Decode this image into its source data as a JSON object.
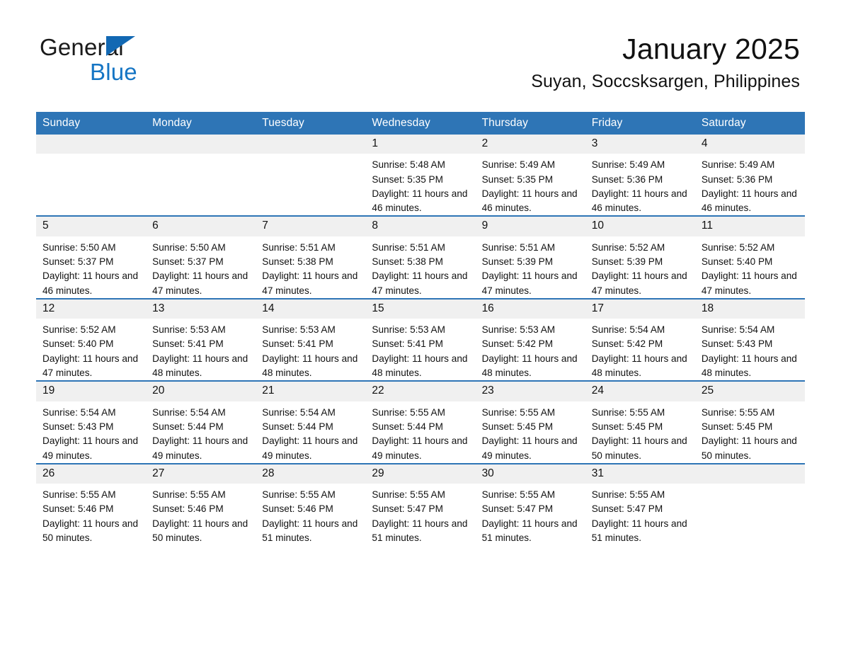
{
  "brand": {
    "name_part1": "General",
    "name_part2": "Blue",
    "triangle_icon": "blue-triangle-icon",
    "accent_color": "#1575c4"
  },
  "header": {
    "title": "January 2025",
    "subtitle": "Suyan, Soccsksargen, Philippines"
  },
  "theme": {
    "header_blue": "#2e75b6",
    "daynum_gray": "#f0f0f0",
    "text": "#111111"
  },
  "weekday_headers": [
    "Sunday",
    "Monday",
    "Tuesday",
    "Wednesday",
    "Thursday",
    "Friday",
    "Saturday"
  ],
  "labels": {
    "sunrise_prefix": "Sunrise:",
    "sunset_prefix": "Sunset:",
    "daylight_prefix": "Daylight:"
  },
  "weeks": [
    [
      {
        "day": "",
        "empty": true
      },
      {
        "day": "",
        "empty": true
      },
      {
        "day": "",
        "empty": true
      },
      {
        "day": "1",
        "sunrise": "Sunrise: 5:48 AM",
        "sunset": "Sunset: 5:35 PM",
        "daylight": "Daylight: 11 hours and 46 minutes."
      },
      {
        "day": "2",
        "sunrise": "Sunrise: 5:49 AM",
        "sunset": "Sunset: 5:35 PM",
        "daylight": "Daylight: 11 hours and 46 minutes."
      },
      {
        "day": "3",
        "sunrise": "Sunrise: 5:49 AM",
        "sunset": "Sunset: 5:36 PM",
        "daylight": "Daylight: 11 hours and 46 minutes."
      },
      {
        "day": "4",
        "sunrise": "Sunrise: 5:49 AM",
        "sunset": "Sunset: 5:36 PM",
        "daylight": "Daylight: 11 hours and 46 minutes."
      }
    ],
    [
      {
        "day": "5",
        "sunrise": "Sunrise: 5:50 AM",
        "sunset": "Sunset: 5:37 PM",
        "daylight": "Daylight: 11 hours and 46 minutes."
      },
      {
        "day": "6",
        "sunrise": "Sunrise: 5:50 AM",
        "sunset": "Sunset: 5:37 PM",
        "daylight": "Daylight: 11 hours and 47 minutes."
      },
      {
        "day": "7",
        "sunrise": "Sunrise: 5:51 AM",
        "sunset": "Sunset: 5:38 PM",
        "daylight": "Daylight: 11 hours and 47 minutes."
      },
      {
        "day": "8",
        "sunrise": "Sunrise: 5:51 AM",
        "sunset": "Sunset: 5:38 PM",
        "daylight": "Daylight: 11 hours and 47 minutes."
      },
      {
        "day": "9",
        "sunrise": "Sunrise: 5:51 AM",
        "sunset": "Sunset: 5:39 PM",
        "daylight": "Daylight: 11 hours and 47 minutes."
      },
      {
        "day": "10",
        "sunrise": "Sunrise: 5:52 AM",
        "sunset": "Sunset: 5:39 PM",
        "daylight": "Daylight: 11 hours and 47 minutes."
      },
      {
        "day": "11",
        "sunrise": "Sunrise: 5:52 AM",
        "sunset": "Sunset: 5:40 PM",
        "daylight": "Daylight: 11 hours and 47 minutes."
      }
    ],
    [
      {
        "day": "12",
        "sunrise": "Sunrise: 5:52 AM",
        "sunset": "Sunset: 5:40 PM",
        "daylight": "Daylight: 11 hours and 47 minutes."
      },
      {
        "day": "13",
        "sunrise": "Sunrise: 5:53 AM",
        "sunset": "Sunset: 5:41 PM",
        "daylight": "Daylight: 11 hours and 48 minutes."
      },
      {
        "day": "14",
        "sunrise": "Sunrise: 5:53 AM",
        "sunset": "Sunset: 5:41 PM",
        "daylight": "Daylight: 11 hours and 48 minutes."
      },
      {
        "day": "15",
        "sunrise": "Sunrise: 5:53 AM",
        "sunset": "Sunset: 5:41 PM",
        "daylight": "Daylight: 11 hours and 48 minutes."
      },
      {
        "day": "16",
        "sunrise": "Sunrise: 5:53 AM",
        "sunset": "Sunset: 5:42 PM",
        "daylight": "Daylight: 11 hours and 48 minutes."
      },
      {
        "day": "17",
        "sunrise": "Sunrise: 5:54 AM",
        "sunset": "Sunset: 5:42 PM",
        "daylight": "Daylight: 11 hours and 48 minutes."
      },
      {
        "day": "18",
        "sunrise": "Sunrise: 5:54 AM",
        "sunset": "Sunset: 5:43 PM",
        "daylight": "Daylight: 11 hours and 48 minutes."
      }
    ],
    [
      {
        "day": "19",
        "sunrise": "Sunrise: 5:54 AM",
        "sunset": "Sunset: 5:43 PM",
        "daylight": "Daylight: 11 hours and 49 minutes."
      },
      {
        "day": "20",
        "sunrise": "Sunrise: 5:54 AM",
        "sunset": "Sunset: 5:44 PM",
        "daylight": "Daylight: 11 hours and 49 minutes."
      },
      {
        "day": "21",
        "sunrise": "Sunrise: 5:54 AM",
        "sunset": "Sunset: 5:44 PM",
        "daylight": "Daylight: 11 hours and 49 minutes."
      },
      {
        "day": "22",
        "sunrise": "Sunrise: 5:55 AM",
        "sunset": "Sunset: 5:44 PM",
        "daylight": "Daylight: 11 hours and 49 minutes."
      },
      {
        "day": "23",
        "sunrise": "Sunrise: 5:55 AM",
        "sunset": "Sunset: 5:45 PM",
        "daylight": "Daylight: 11 hours and 49 minutes."
      },
      {
        "day": "24",
        "sunrise": "Sunrise: 5:55 AM",
        "sunset": "Sunset: 5:45 PM",
        "daylight": "Daylight: 11 hours and 50 minutes."
      },
      {
        "day": "25",
        "sunrise": "Sunrise: 5:55 AM",
        "sunset": "Sunset: 5:45 PM",
        "daylight": "Daylight: 11 hours and 50 minutes."
      }
    ],
    [
      {
        "day": "26",
        "sunrise": "Sunrise: 5:55 AM",
        "sunset": "Sunset: 5:46 PM",
        "daylight": "Daylight: 11 hours and 50 minutes."
      },
      {
        "day": "27",
        "sunrise": "Sunrise: 5:55 AM",
        "sunset": "Sunset: 5:46 PM",
        "daylight": "Daylight: 11 hours and 50 minutes."
      },
      {
        "day": "28",
        "sunrise": "Sunrise: 5:55 AM",
        "sunset": "Sunset: 5:46 PM",
        "daylight": "Daylight: 11 hours and 51 minutes."
      },
      {
        "day": "29",
        "sunrise": "Sunrise: 5:55 AM",
        "sunset": "Sunset: 5:47 PM",
        "daylight": "Daylight: 11 hours and 51 minutes."
      },
      {
        "day": "30",
        "sunrise": "Sunrise: 5:55 AM",
        "sunset": "Sunset: 5:47 PM",
        "daylight": "Daylight: 11 hours and 51 minutes."
      },
      {
        "day": "31",
        "sunrise": "Sunrise: 5:55 AM",
        "sunset": "Sunset: 5:47 PM",
        "daylight": "Daylight: 11 hours and 51 minutes."
      },
      {
        "day": "",
        "empty": true
      }
    ]
  ]
}
